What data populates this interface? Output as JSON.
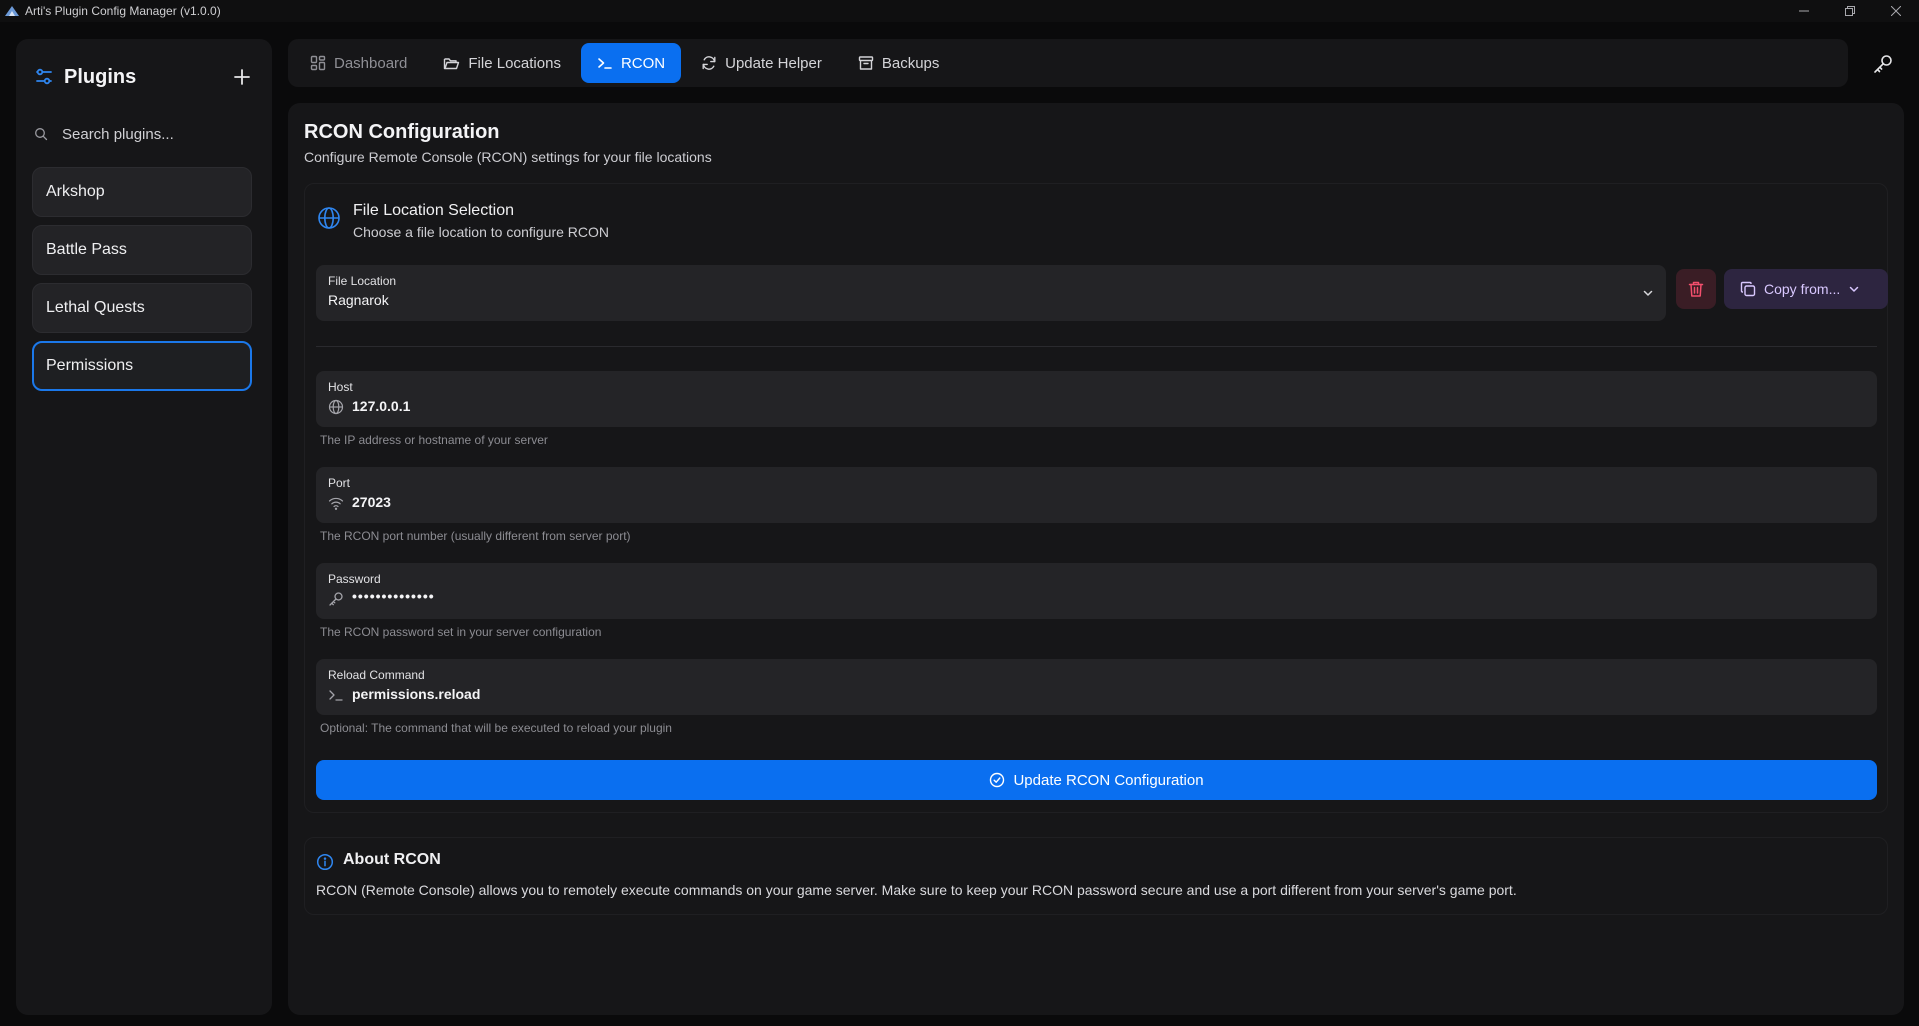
{
  "window": {
    "title": "Arti's Plugin Config Manager (v1.0.0)"
  },
  "sidebar": {
    "title": "Plugins",
    "search_placeholder": "Search plugins...",
    "items": [
      {
        "label": "Arkshop"
      },
      {
        "label": "Battle Pass"
      },
      {
        "label": "Lethal Quests"
      },
      {
        "label": "Permissions",
        "active": true
      }
    ]
  },
  "nav": {
    "tabs": [
      {
        "label": "Dashboard",
        "icon": "dashboard-icon"
      },
      {
        "label": "File Locations",
        "icon": "folder-icon"
      },
      {
        "label": "RCON",
        "icon": "terminal-icon",
        "active": true
      },
      {
        "label": "Update Helper",
        "icon": "refresh-icon"
      },
      {
        "label": "Backups",
        "icon": "archive-icon"
      }
    ]
  },
  "main": {
    "title": "RCON Configuration",
    "subtitle": "Configure Remote Console (RCON) settings for your file locations",
    "location_card": {
      "title": "File Location Selection",
      "subtitle": "Choose a file location to configure RCON",
      "select_label": "File Location",
      "select_value": "Ragnarok",
      "copy_label": "Copy from..."
    },
    "fields": {
      "host": {
        "label": "Host",
        "value": "127.0.0.1",
        "help": "The IP address or hostname of your server"
      },
      "port": {
        "label": "Port",
        "value": "27023",
        "help": "The RCON port number (usually different from server port)"
      },
      "password": {
        "label": "Password",
        "value": "••••••••••••••",
        "help": "The RCON password set in your server configuration"
      },
      "reload": {
        "label": "Reload Command",
        "value": "permissions.reload",
        "help": "Optional: The command that will be executed to reload your plugin"
      }
    },
    "update_label": "Update RCON Configuration",
    "about": {
      "title": "About RCON",
      "text": "RCON (Remote Console) allows you to remotely execute commands on your game server. Make sure to keep your RCON password secure and use a port different from your server's game port."
    }
  },
  "colors": {
    "accent": "#0a6ff0",
    "danger": "#f24f6d",
    "background": "#0a0a0b",
    "panel": "#161618"
  }
}
